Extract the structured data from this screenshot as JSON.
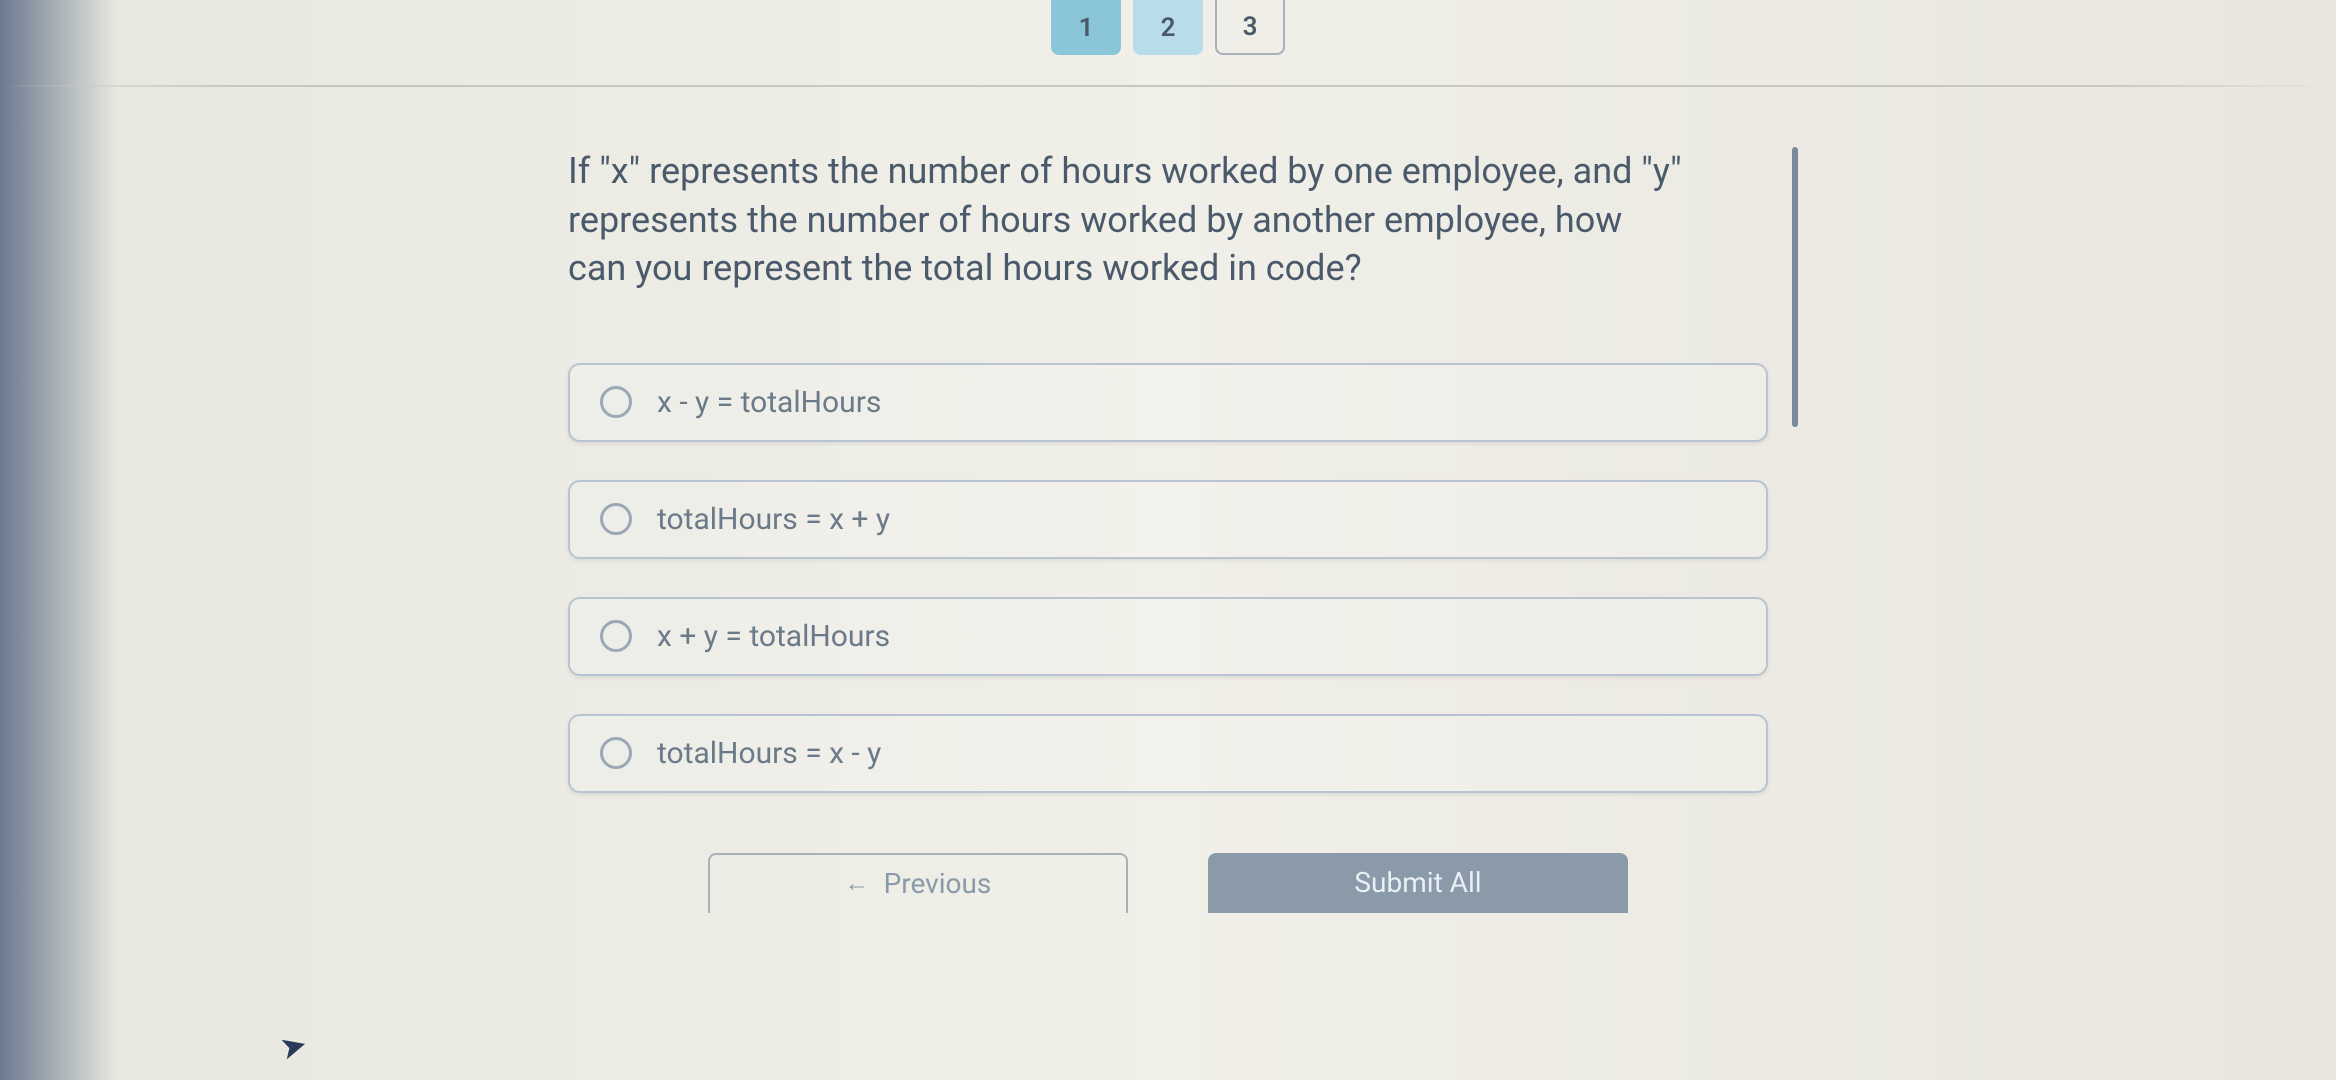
{
  "pagination": {
    "items": [
      {
        "label": "1",
        "state": "completed"
      },
      {
        "label": "2",
        "state": "current"
      },
      {
        "label": "3",
        "state": "upcoming"
      }
    ]
  },
  "question": {
    "text": "If \"x\" represents the number of hours worked by one employee, and \"y\" represents the number of hours worked by another employee, how can you represent the total hours worked in code?"
  },
  "options": [
    {
      "text": "x - y = totalHours"
    },
    {
      "text": "totalHours = x + y"
    },
    {
      "text": "x + y = totalHours"
    },
    {
      "text": "totalHours = x - y"
    }
  ],
  "buttons": {
    "previous": "Previous",
    "submit": "Submit All"
  }
}
